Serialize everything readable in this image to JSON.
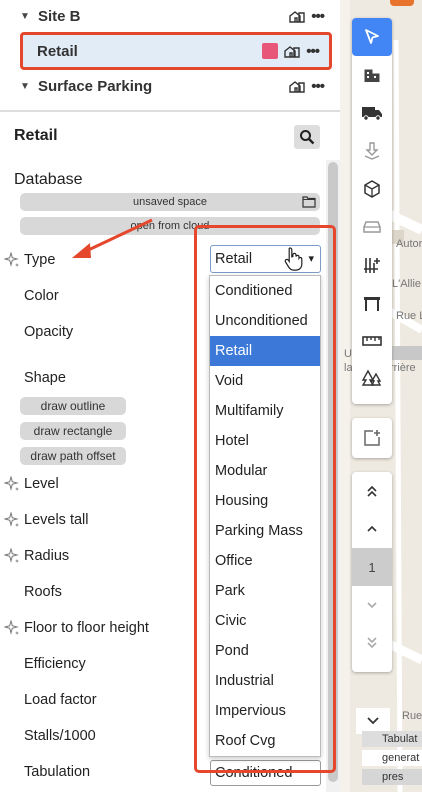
{
  "tree": {
    "site_b": "Site B",
    "retail": "Retail",
    "surface_parking": "Surface Parking"
  },
  "panel": {
    "title": "Retail",
    "database_label": "Database",
    "unsaved_space": "unsaved space",
    "open_from_cloud": "open from cloud"
  },
  "props": {
    "type": "Type",
    "color": "Color",
    "opacity": "Opacity",
    "shape": "Shape",
    "draw_outline": "draw outline",
    "draw_rectangle": "draw rectangle",
    "draw_path_offset": "draw path offset",
    "level": "Level",
    "levels_tall": "Levels tall",
    "radius": "Radius",
    "roofs": "Roofs",
    "floor_to_floor": "Floor to floor height",
    "efficiency": "Efficiency",
    "load_factor": "Load factor",
    "stalls": "Stalls/1000",
    "tabulation": "Tabulation"
  },
  "type_select": {
    "value": "Retail",
    "options": [
      "Conditioned",
      "Unconditioned",
      "Retail",
      "Void",
      "Multifamily",
      "Hotel",
      "Modular",
      "Housing",
      "Parking Mass",
      "Office",
      "Park",
      "Civic",
      "Pond",
      "Industrial",
      "Impervious",
      "Roof Cvg"
    ],
    "selected_index": 2
  },
  "tabulation_select": {
    "value": "Conditioned"
  },
  "levels": {
    "current": "1"
  },
  "map": {
    "street_1": "Autoro",
    "street_2": "L'Allie",
    "street_3": "Rue L",
    "street_4": "Rue",
    "place_1": "U",
    "place_2": "la",
    "place_3": "rrière"
  },
  "map_buttons": {
    "tabulation": "Tabulat",
    "generate": "generat",
    "present": "pres"
  },
  "colors": {
    "accent": "#4285f4",
    "highlight": "#e4472c",
    "retail_swatch": "#e8567a",
    "selected_option": "#3b78d8"
  }
}
